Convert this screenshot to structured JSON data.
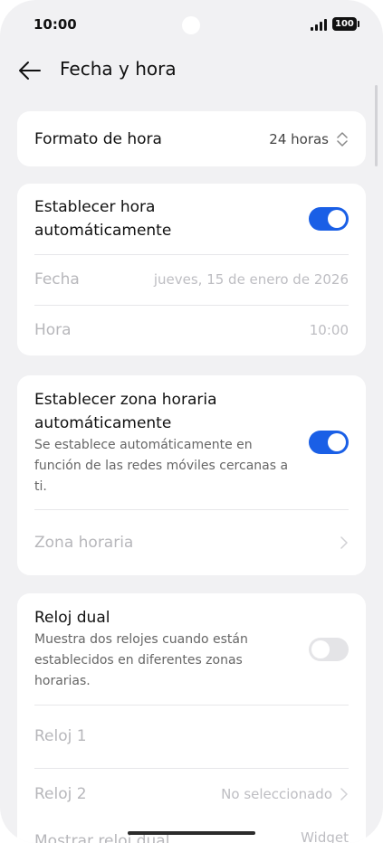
{
  "status": {
    "time": "10:00",
    "battery": "100"
  },
  "header": {
    "title": "Fecha y hora"
  },
  "format": {
    "label": "Formato de hora",
    "value": "24 horas"
  },
  "auto_time": {
    "label": "Establecer hora automáticamente",
    "enabled": true,
    "date_label": "Fecha",
    "date_value": "jueves, 15 de enero de 2026",
    "time_label": "Hora",
    "time_value": "10:00"
  },
  "auto_zone": {
    "label": "Establecer zona horaria automáticamente",
    "description": "Se establece automáticamente en función de las redes móviles cercanas a ti.",
    "enabled": true,
    "zone_label": "Zona horaria"
  },
  "dual": {
    "label": "Reloj dual",
    "description": "Muestra dos relojes cuando están establecidos en diferentes zonas horarias.",
    "enabled": false,
    "clock1_label": "Reloj 1",
    "clock2_label": "Reloj 2",
    "clock2_value": "No seleccionado",
    "show_label": "Mostrar reloj dual",
    "show_value": "Widget"
  },
  "colors": {
    "accent": "#1a5fe6",
    "background": "#f1f1f3",
    "card": "#ffffff"
  }
}
